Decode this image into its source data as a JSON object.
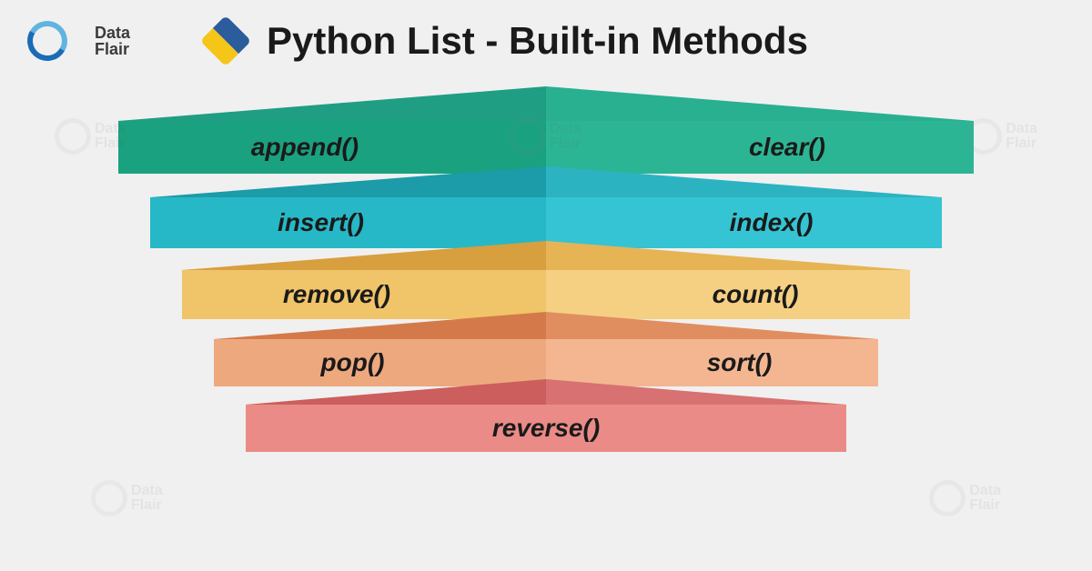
{
  "brand": {
    "line1": "Data",
    "line2": "Flair"
  },
  "title": "Python List - Built-in Methods",
  "chart_data": {
    "type": "bar",
    "title": "Python List - Built-in Methods",
    "tiers": [
      {
        "left": "append()",
        "right": "clear()",
        "color": "teal"
      },
      {
        "left": "insert()",
        "right": "index()",
        "color": "cyan"
      },
      {
        "left": "remove()",
        "right": "count()",
        "color": "gold"
      },
      {
        "left": "pop()",
        "right": "sort()",
        "color": "peach"
      },
      {
        "center": "reverse()",
        "color": "coral"
      }
    ]
  },
  "watermark": {
    "line1": "Data",
    "line2": "Flair"
  }
}
